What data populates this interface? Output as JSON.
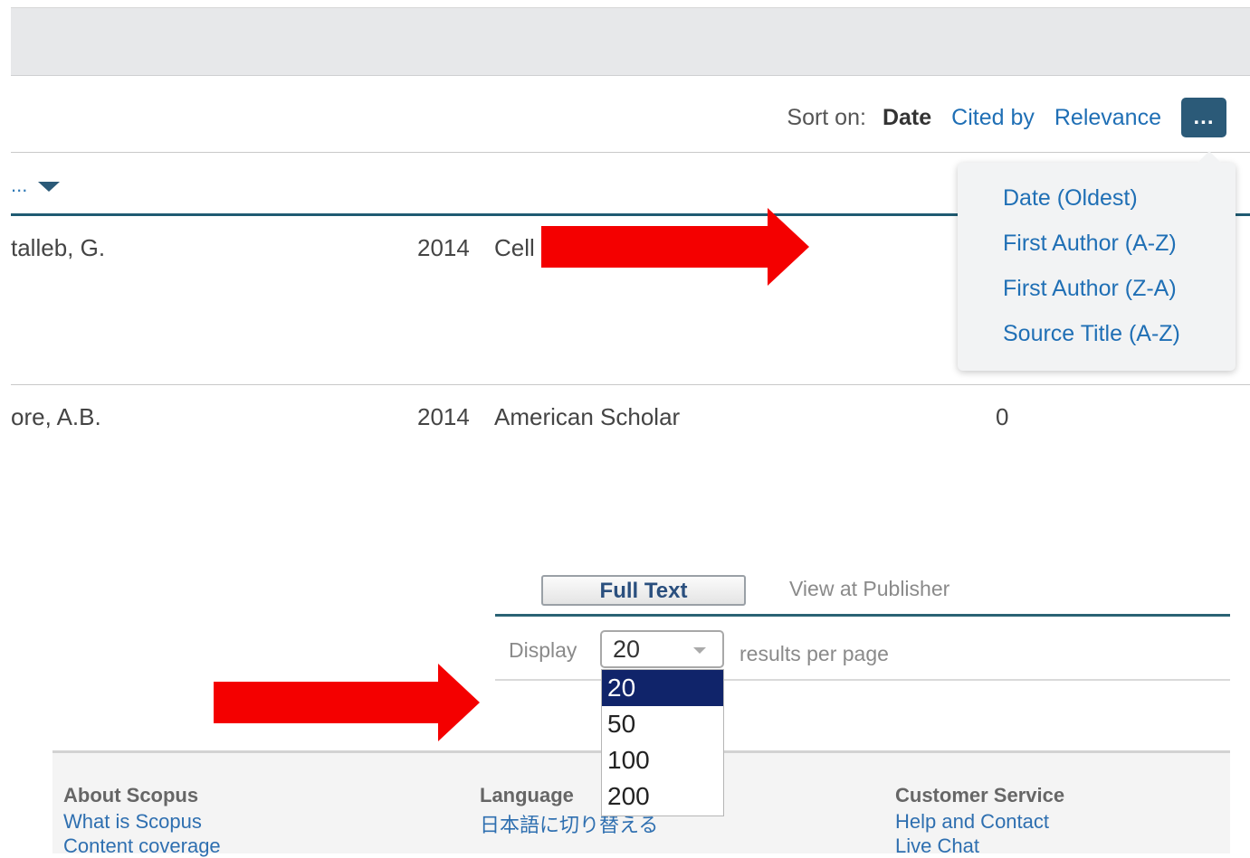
{
  "sort": {
    "label": "Sort on:",
    "options": [
      "Date",
      "Cited by",
      "Relevance"
    ],
    "more_label": "...",
    "menu": [
      "Date (Oldest)",
      "First Author (A-Z)",
      "First Author (Z-A)",
      "Source Title (A-Z)"
    ]
  },
  "results": {
    "author_header": "...",
    "rows": [
      {
        "author": "talleb, G.",
        "year": "2014",
        "source": "Cell",
        "cited": ""
      },
      {
        "author": "ore, A.B.",
        "year": "2014",
        "source": "American Scholar",
        "cited": "0"
      }
    ]
  },
  "actions": {
    "full_text": "Full Text",
    "view_publisher": "View at Publisher"
  },
  "display": {
    "label": "Display",
    "value": "20",
    "suffix": "results per page",
    "options": [
      "20",
      "50",
      "100",
      "200"
    ]
  },
  "footer": {
    "about_heading": "About Scopus",
    "about_links": [
      "What is Scopus",
      "Content coverage"
    ],
    "language_heading": "Language",
    "language_link": "日本語に切り替える",
    "service_heading": "Customer Service",
    "service_links": [
      "Help and Contact",
      "Live Chat"
    ]
  },
  "colors": {
    "arrow": "#f40000",
    "accent": "#2b5a78",
    "selected_option": "#10246a"
  }
}
